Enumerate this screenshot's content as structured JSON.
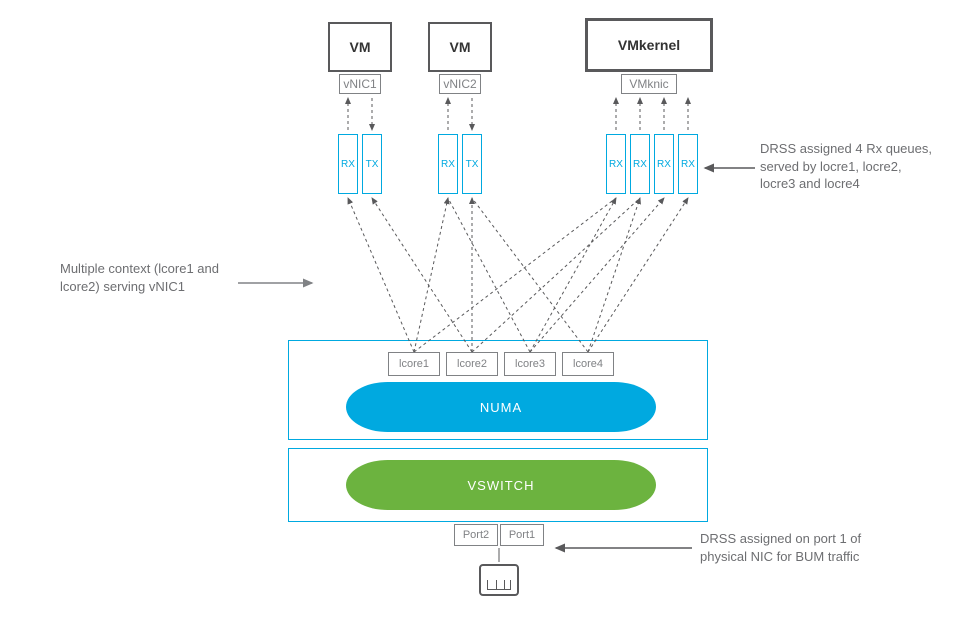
{
  "vms": {
    "vm1": {
      "label": "VM",
      "nic": "vNIC1",
      "rx": "RX",
      "tx": "TX"
    },
    "vm2": {
      "label": "VM",
      "nic": "vNIC2",
      "rx": "RX",
      "tx": "TX"
    },
    "vmk": {
      "label": "VMkernel",
      "nic": "VMknic",
      "rx": "RX"
    }
  },
  "numa": {
    "lcores": {
      "l1": "lcore1",
      "l2": "lcore2",
      "l3": "lcore3",
      "l4": "lcore4"
    },
    "label": "NUMA"
  },
  "vswitch": {
    "label": "VSWITCH",
    "ports": {
      "p2": "Port2",
      "p1": "Port1"
    }
  },
  "annotations": {
    "left": "Multiple context (lcore1 and lcore2) serving vNIC1",
    "right_top": "DRSS assigned 4 Rx queues, served by locre1, locre2, locre3 and locre4",
    "right_bottom": "DRSS assigned on port 1 of physical NIC for BUM traffic"
  }
}
